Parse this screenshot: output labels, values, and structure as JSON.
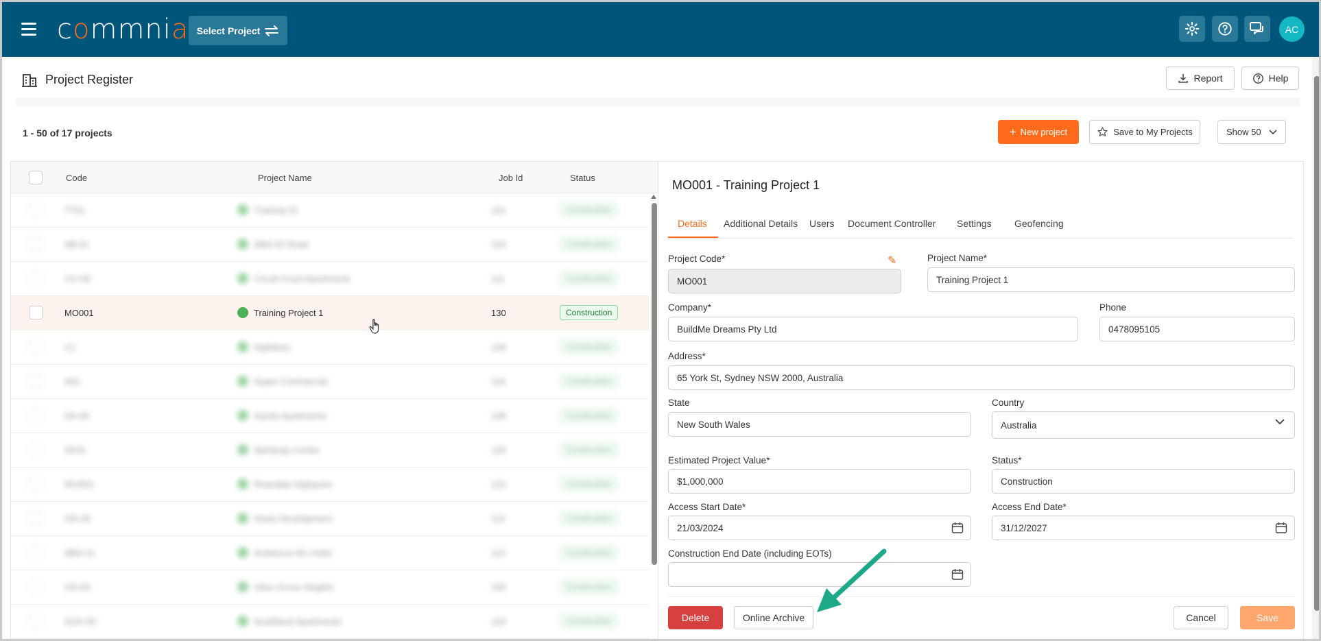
{
  "header": {
    "logo_text": "commnia",
    "select_project_label": "Select Project",
    "avatar_initials": "AC",
    "icons": [
      "settings-icon",
      "help-icon",
      "chat-icon"
    ]
  },
  "page": {
    "title": "Project Register",
    "report_label": "Report",
    "help_label": "Help",
    "count_text": "1 - 50 of 17 projects",
    "new_project_label": "New project",
    "save_my_projects_label": "Save to My Projects",
    "show_label": "Show 50"
  },
  "table": {
    "columns": [
      "Code",
      "Project Name",
      "Job Id",
      "Status"
    ],
    "rows": [
      {
        "code": "TT01",
        "name": "Training 01",
        "job": "101",
        "status": "Construction",
        "blurred": true
      },
      {
        "code": "AB-01",
        "name": "ABA-02 Road",
        "job": "102",
        "status": "Construction",
        "blurred": true
      },
      {
        "code": "CO-00",
        "name": "Circell Court Apartments",
        "job": "111",
        "status": "Construction",
        "blurred": true
      },
      {
        "code": "MO001",
        "name": "Training Project 1",
        "job": "130",
        "status": "Construction",
        "blurred": false
      },
      {
        "code": "C1",
        "name": "Highlines",
        "job": "109",
        "status": "Construction",
        "blurred": true
      },
      {
        "code": "S01",
        "name": "Super Commercial",
        "job": "116",
        "status": "Construction",
        "blurred": true
      },
      {
        "code": "SA-00",
        "name": "Sands Apartments",
        "job": "108",
        "status": "Construction",
        "blurred": true
      },
      {
        "code": "SK01",
        "name": "Skinbody Centre",
        "job": "120",
        "status": "Construction",
        "blurred": true
      },
      {
        "code": "RIV001",
        "name": "Riverdale Highpoint",
        "job": "122",
        "status": "Construction",
        "blurred": true
      },
      {
        "code": "OD-00",
        "name": "Oasis Development",
        "job": "112",
        "status": "Construction",
        "blurred": true
      },
      {
        "code": "ABA-11",
        "name": "Antelence M1 Hotel",
        "job": "110",
        "status": "Construction",
        "blurred": true
      },
      {
        "code": "OS-00",
        "name": "Olive Grove Heights",
        "job": "105",
        "status": "Construction",
        "blurred": true
      },
      {
        "code": "SUH-00",
        "name": "Southland Apartments",
        "job": "104",
        "status": "Construction",
        "blurred": true
      }
    ]
  },
  "detail": {
    "title": "MO001 - Training Project 1",
    "tabs": [
      "Details",
      "Additional Details",
      "Users",
      "Document Controller",
      "Settings",
      "Geofencing"
    ],
    "fields": {
      "project_code_label": "Project Code*",
      "project_code": "MO001",
      "project_name_label": "Project Name*",
      "project_name": "Training Project 1",
      "company_label": "Company*",
      "company": "BuildMe Dreams Pty Ltd",
      "phone_label": "Phone",
      "phone": "0478095105",
      "address_label": "Address*",
      "address": "65 York St, Sydney NSW 2000, Australia",
      "state_label": "State",
      "state": "New South Wales",
      "country_label": "Country",
      "country": "Australia",
      "value_label": "Estimated Project Value*",
      "value": "$1,000,000",
      "status_label": "Status*",
      "status": "Construction",
      "start_label": "Access Start Date*",
      "start": "21/03/2024",
      "end_label": "Access End Date*",
      "end": "31/12/2027",
      "construction_end_label": "Construction End Date (including EOTs)",
      "construction_end": ""
    },
    "buttons": {
      "delete": "Delete",
      "archive": "Online Archive",
      "cancel": "Cancel",
      "save": "Save"
    }
  },
  "colors": {
    "header_bg": "#00567a",
    "accent": "#ff6b1a",
    "delete": "#d6403f",
    "annotation_arrow": "#1ea88a"
  }
}
